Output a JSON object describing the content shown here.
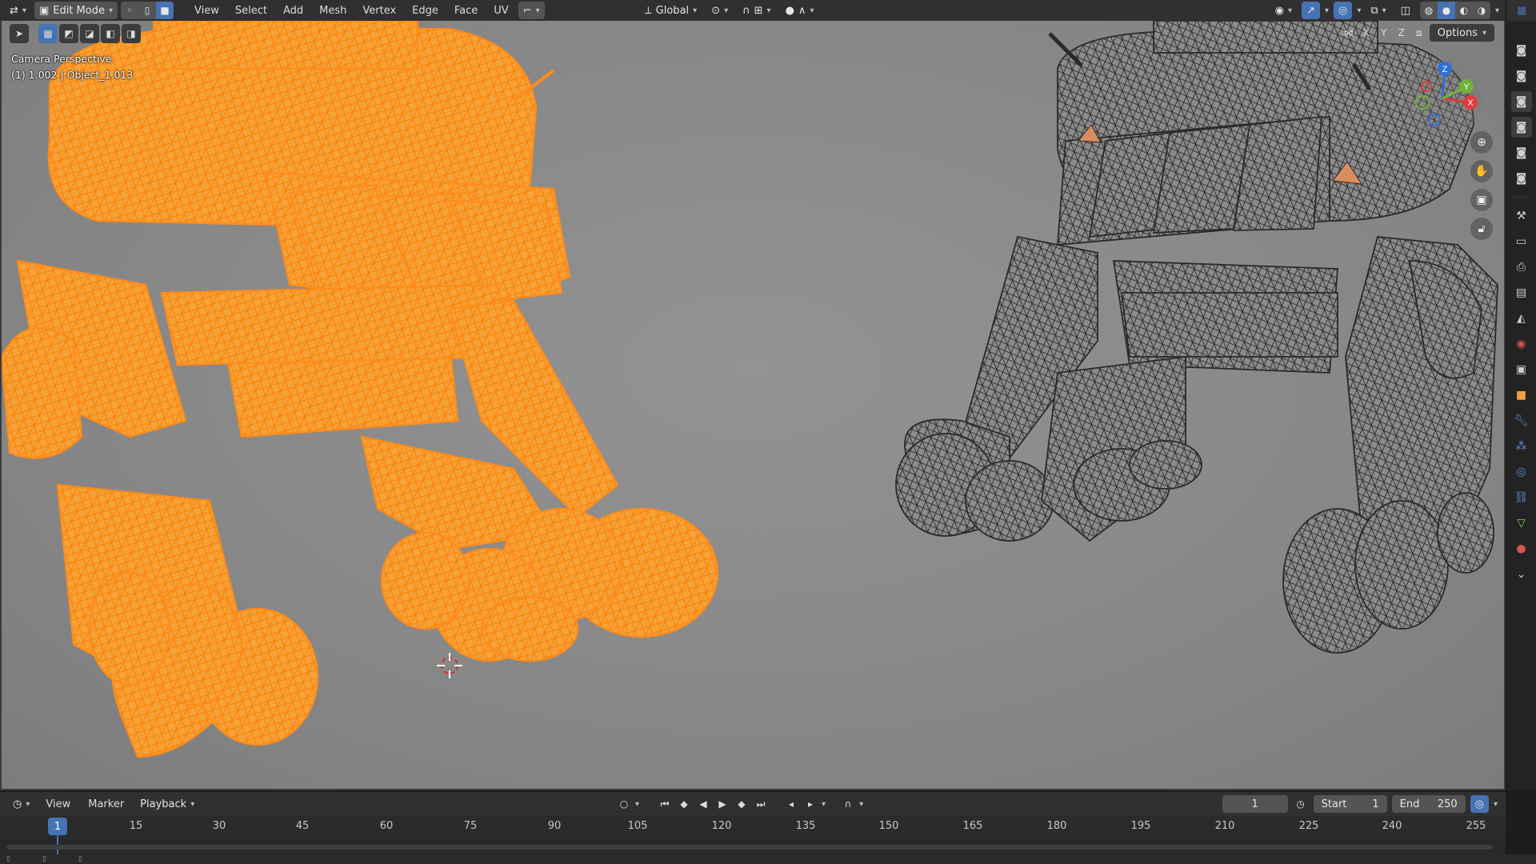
{
  "header": {
    "mode_label": "Edit Mode",
    "menus": [
      "View",
      "Select",
      "Add",
      "Mesh",
      "Vertex",
      "Edge",
      "Face",
      "UV"
    ],
    "orientation_label": "Global"
  },
  "viewport": {
    "camera_label": "Camera Perspective",
    "object_label": "(1) 1.002 | Object_1.013",
    "axis_labels": [
      "X",
      "Y",
      "Z"
    ],
    "options_label": "Options",
    "gizmo": {
      "x": "X",
      "y": "Y",
      "z": "Z"
    }
  },
  "timeline": {
    "menus": [
      "View",
      "Marker",
      "Playback"
    ],
    "current_frame": "1",
    "start_label": "Start",
    "start_value": "1",
    "end_label": "End",
    "end_value": "250",
    "ruler_ticks": [
      "15",
      "30",
      "45",
      "60",
      "75",
      "90",
      "105",
      "120",
      "135",
      "150",
      "165",
      "180",
      "195",
      "210",
      "225",
      "240",
      "255"
    ],
    "playhead_frame": "1"
  },
  "colors": {
    "selected_wire": "#ff8c1a",
    "unselected_wire": "#2a2a2a",
    "accent": "#4772b3",
    "viewport_bg": "#8a8a8a"
  },
  "icons": {
    "editor_type": "editor-type-icon",
    "mode": "edit-mode-icon",
    "vertex_select": "vertex-select-icon",
    "edge_select": "edge-select-icon",
    "face_select": "face-select-icon",
    "orientation": "transform-orientation-icon",
    "pivot": "pivot-icon",
    "snap": "snap-icon",
    "proportional": "proportional-edit-icon",
    "visibility": "visibility-icon",
    "gizmo_toggle": "gizmo-icon",
    "overlay": "overlay-icon",
    "xray": "xray-icon",
    "shading": "shading-icons",
    "zoom": "zoom-icon",
    "pan": "pan-icon",
    "camera_view": "camera-icon",
    "lock": "lock-icon"
  }
}
